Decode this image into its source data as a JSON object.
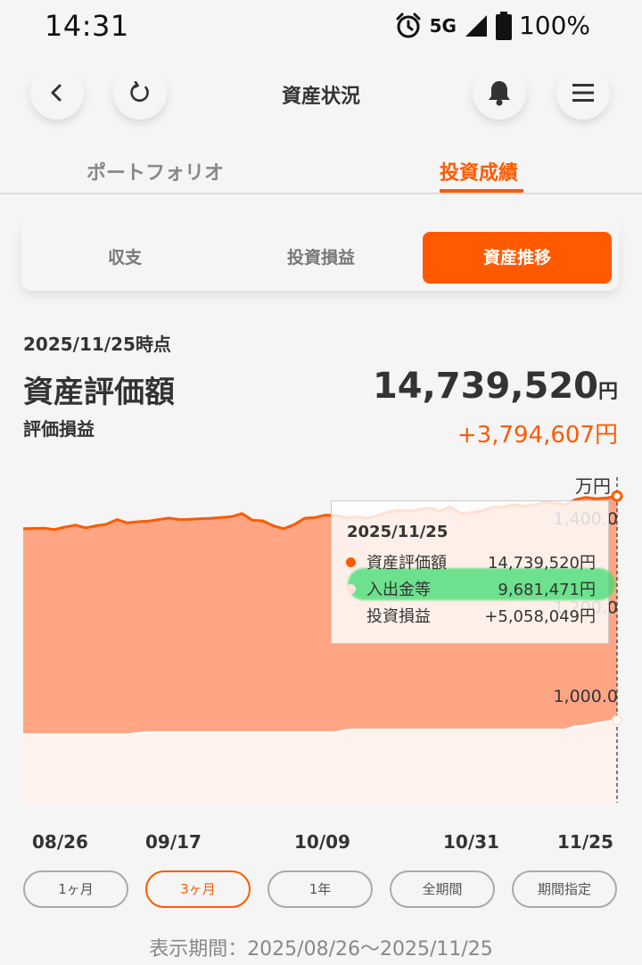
{
  "status_bar": {
    "time": "14:31",
    "network": "5G",
    "battery": "100%"
  },
  "header": {
    "title": "資産状況"
  },
  "tabs": [
    {
      "label": "ポートフォリオ",
      "active": false
    },
    {
      "label": "投資成績",
      "active": true
    }
  ],
  "segments": [
    {
      "label": "収支",
      "active": false
    },
    {
      "label": "投資損益",
      "active": false
    },
    {
      "label": "資産推移",
      "active": true
    }
  ],
  "summary": {
    "as_of": "2025/11/25時点",
    "asset_label": "資産評価額",
    "asset_value": "14,739,520",
    "asset_unit": "円",
    "pl_label": "評価損益",
    "pl_value": "+3,794,607円"
  },
  "chart_data": {
    "type": "area",
    "unit_label": "万円",
    "y_ticks": [
      "1,400.0",
      "1,200.0",
      "1,000.0"
    ],
    "ylim": [
      835,
      1480
    ],
    "x_ticks": [
      "08/26",
      "09/17",
      "10/09",
      "10/31",
      "11/25"
    ],
    "series": [
      {
        "name": "資産評価額",
        "values": [
          1400.5,
          1401,
          1401.5,
          1398.5,
          1404,
          1408.5,
          1402.5,
          1407,
          1410.5,
          1421,
          1413.5,
          1416,
          1417.5,
          1421,
          1424.5,
          1421,
          1421.5,
          1423,
          1424,
          1425.5,
          1427.5,
          1434.5,
          1419.5,
          1418,
          1407,
          1400.5,
          1409.5,
          1424,
          1425.5,
          1431,
          1430.5,
          1425,
          1427.5,
          1424,
          1430,
          1438,
          1441.5,
          1440,
          1443.5,
          1447,
          1439.5,
          1450,
          1434.5,
          1437,
          1440,
          1448.5,
          1449,
          1454,
          1451,
          1453,
          1460.5,
          1458,
          1454,
          1466,
          1471,
          1468,
          1469.5,
          1473.95
        ]
      },
      {
        "name": "入出金等",
        "values": [
          937,
          937,
          937,
          937,
          937,
          937,
          937,
          937,
          937,
          937,
          937,
          940,
          942,
          942,
          942,
          942,
          942,
          942,
          942,
          942,
          942,
          942,
          942,
          942,
          942,
          942,
          942,
          942,
          942,
          942,
          942,
          947,
          948,
          948,
          948,
          948,
          948,
          948,
          948,
          948,
          948,
          948,
          948,
          948,
          948,
          948,
          948,
          948,
          948,
          948,
          948,
          948,
          948,
          955,
          957,
          962,
          966,
          968.15
        ]
      }
    ]
  },
  "tooltip": {
    "date": "2025/11/25",
    "rows": [
      {
        "name": "資産評価額",
        "value": "14,739,520円",
        "color": "#ff5a00"
      },
      {
        "name": "入出金等",
        "value": "9,681,471円",
        "color": "#fde4da"
      },
      {
        "name": "投資損益",
        "value": "+5,058,049円",
        "color": ""
      }
    ]
  },
  "ranges": [
    {
      "label": "1ヶ月",
      "active": false
    },
    {
      "label": "3ヶ月",
      "active": true
    },
    {
      "label": "1年",
      "active": false
    },
    {
      "label": "全期間",
      "active": false
    },
    {
      "label": "期間指定",
      "active": false
    }
  ],
  "display_period": "表示期間：2025/08/26〜2025/11/25",
  "colors": {
    "accent": "#ff5a00",
    "area_assets": "#ffa584",
    "area_deposits": "#fff1ec"
  },
  "icons": [
    "back-icon",
    "refresh-icon",
    "bell-icon",
    "menu-icon",
    "alarm-icon",
    "signal-icon",
    "battery-icon"
  ]
}
